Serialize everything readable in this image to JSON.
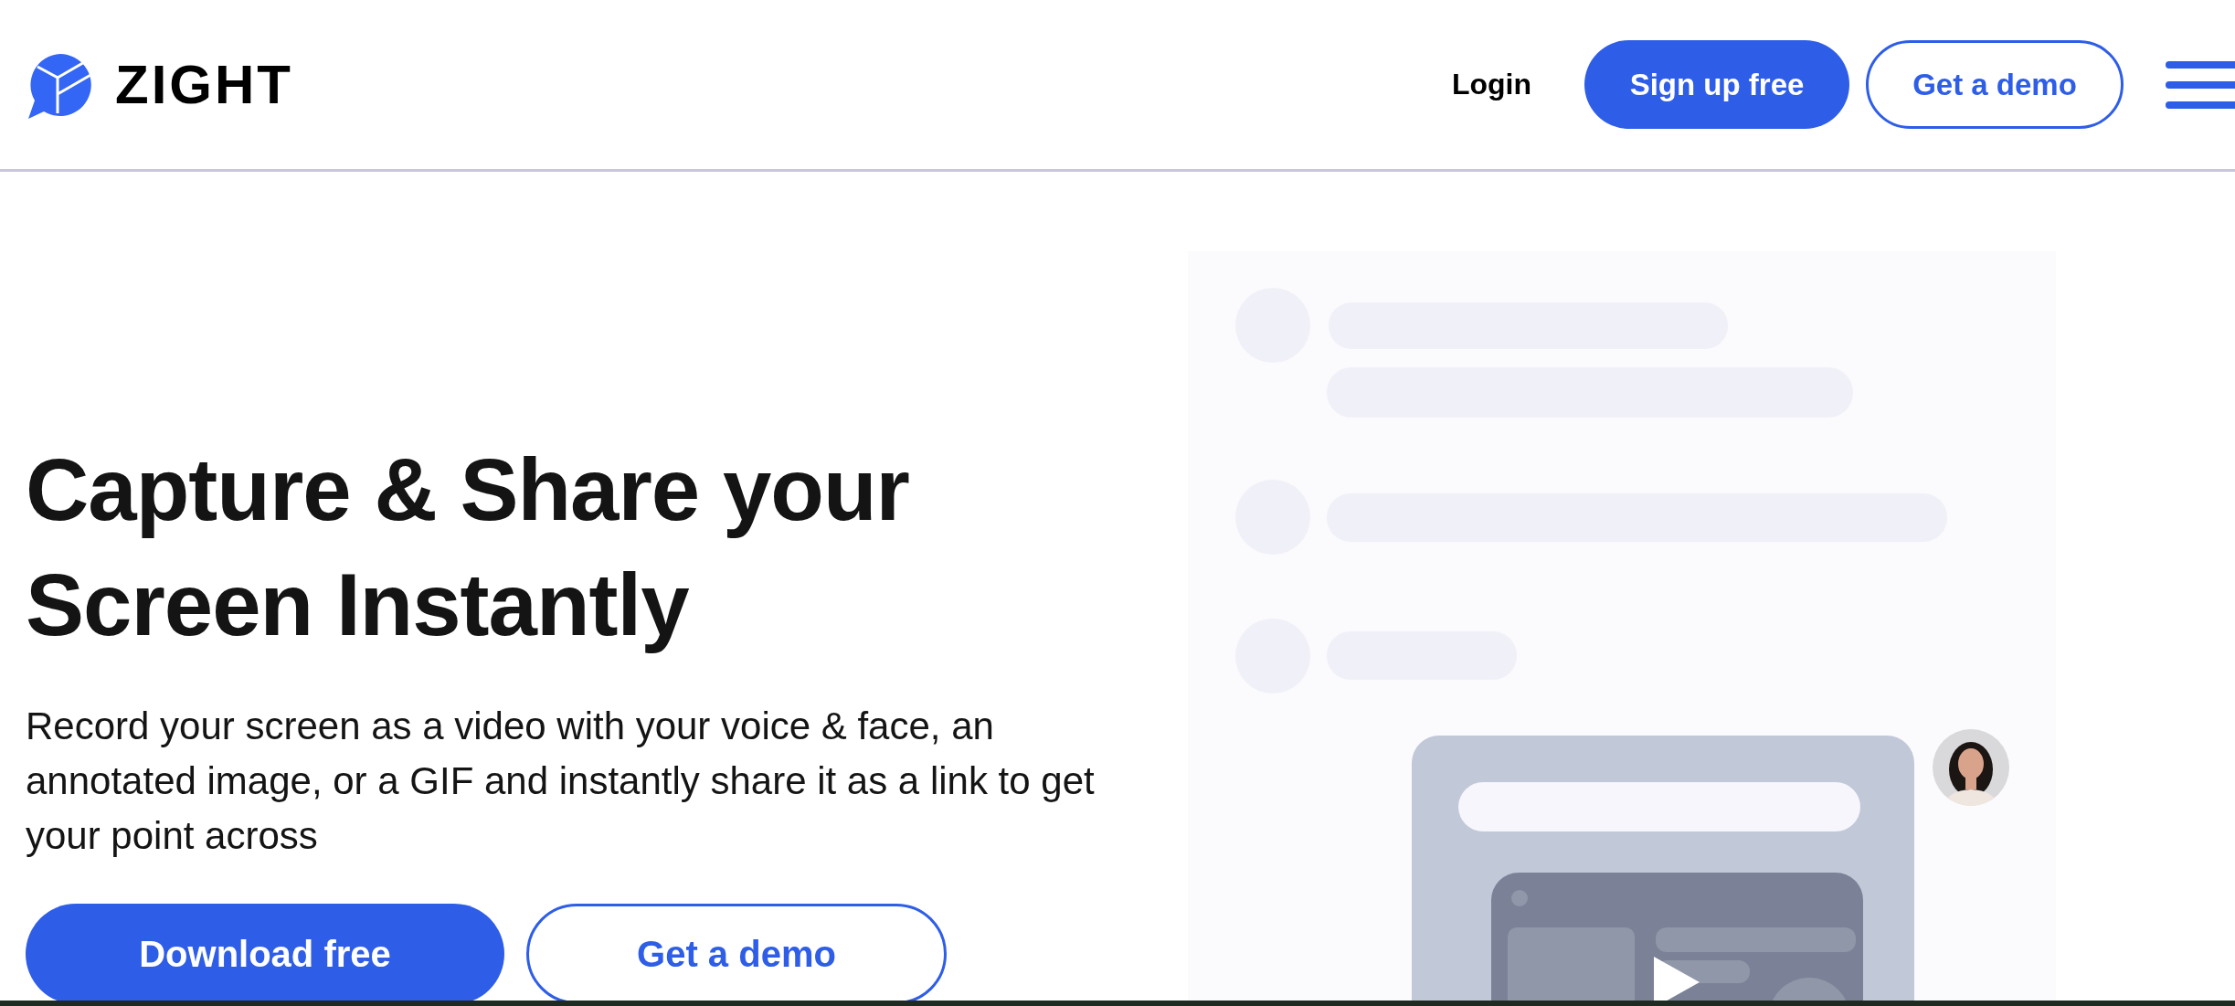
{
  "header": {
    "logo": "ZIGHT",
    "nav": [
      {
        "label": "Login",
        "kind": "link"
      },
      {
        "label": "Sign up free",
        "kind": "primary"
      },
      {
        "label": "Get a demo",
        "kind": "outline"
      }
    ]
  },
  "hero": {
    "title_lines": [
      "Capture & Share your",
      "Screen Instantly"
    ],
    "description": "Record your screen as a video with your voice & face, an annotated image, or a GIF and instantly share it as a link to get your point across",
    "buttons": [
      {
        "label": "Download free",
        "kind": "primary"
      },
      {
        "label": "Get a demo",
        "kind": "outline"
      }
    ]
  }
}
